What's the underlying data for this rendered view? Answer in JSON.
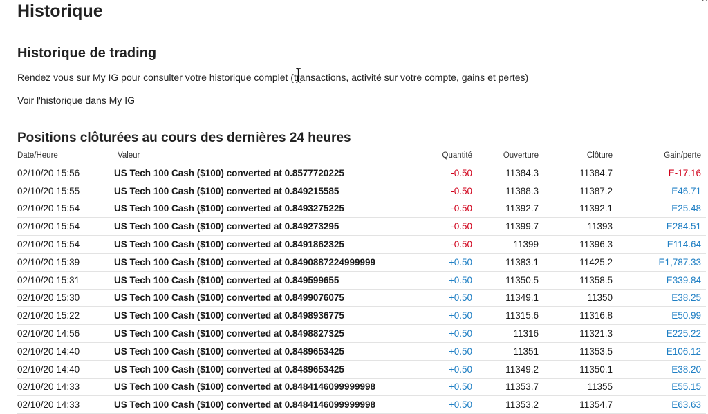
{
  "header": {
    "title": "Historique",
    "close_label": "×"
  },
  "trading_history": {
    "title": "Historique de trading",
    "description": "Rendez vous sur My IG pour consulter votre historique complet (transactions, activité sur votre compte, gains et pertes)",
    "link_label": "Voir l'historique dans My IG"
  },
  "closed_positions": {
    "title": "Positions clôturées au cours des dernières 24 heures",
    "columns": {
      "date": "Date/Heure",
      "value": "Valeur",
      "quantity": "Quantité",
      "open": "Ouverture",
      "close": "Clôture",
      "pl": "Gain/perte"
    },
    "rows": [
      {
        "date": "02/10/20 15:56",
        "value": "US Tech 100 Cash ($100) converted at 0.8577720225",
        "quantity": "-0.50",
        "open": "11384.3",
        "close": "11384.7",
        "pl": "E-17.16",
        "qty_sign": "neg",
        "pl_sign": "neg"
      },
      {
        "date": "02/10/20 15:55",
        "value": "US Tech 100 Cash ($100) converted at 0.849215585",
        "quantity": "-0.50",
        "open": "11388.3",
        "close": "11387.2",
        "pl": "E46.71",
        "qty_sign": "neg",
        "pl_sign": "pos"
      },
      {
        "date": "02/10/20 15:54",
        "value": "US Tech 100 Cash ($100) converted at 0.8493275225",
        "quantity": "-0.50",
        "open": "11392.7",
        "close": "11392.1",
        "pl": "E25.48",
        "qty_sign": "neg",
        "pl_sign": "pos"
      },
      {
        "date": "02/10/20 15:54",
        "value": "US Tech 100 Cash ($100) converted at 0.849273295",
        "quantity": "-0.50",
        "open": "11399.7",
        "close": "11393",
        "pl": "E284.51",
        "qty_sign": "neg",
        "pl_sign": "pos"
      },
      {
        "date": "02/10/20 15:54",
        "value": "US Tech 100 Cash ($100) converted at 0.8491862325",
        "quantity": "-0.50",
        "open": "11399",
        "close": "11396.3",
        "pl": "E114.64",
        "qty_sign": "neg",
        "pl_sign": "pos"
      },
      {
        "date": "02/10/20 15:39",
        "value": "US Tech 100 Cash ($100) converted at 0.8490887224999999",
        "quantity": "+0.50",
        "open": "11383.1",
        "close": "11425.2",
        "pl": "E1,787.33",
        "qty_sign": "pos",
        "pl_sign": "pos"
      },
      {
        "date": "02/10/20 15:31",
        "value": "US Tech 100 Cash ($100) converted at 0.849599655",
        "quantity": "+0.50",
        "open": "11350.5",
        "close": "11358.5",
        "pl": "E339.84",
        "qty_sign": "pos",
        "pl_sign": "pos"
      },
      {
        "date": "02/10/20 15:30",
        "value": "US Tech 100 Cash ($100) converted at 0.8499076075",
        "quantity": "+0.50",
        "open": "11349.1",
        "close": "11350",
        "pl": "E38.25",
        "qty_sign": "pos",
        "pl_sign": "pos"
      },
      {
        "date": "02/10/20 15:22",
        "value": "US Tech 100 Cash ($100) converted at 0.8498936775",
        "quantity": "+0.50",
        "open": "11315.6",
        "close": "11316.8",
        "pl": "E50.99",
        "qty_sign": "pos",
        "pl_sign": "pos"
      },
      {
        "date": "02/10/20 14:56",
        "value": "US Tech 100 Cash ($100) converted at 0.8498827325",
        "quantity": "+0.50",
        "open": "11316",
        "close": "11321.3",
        "pl": "E225.22",
        "qty_sign": "pos",
        "pl_sign": "pos"
      },
      {
        "date": "02/10/20 14:40",
        "value": "US Tech 100 Cash ($100) converted at 0.8489653425",
        "quantity": "+0.50",
        "open": "11351",
        "close": "11353.5",
        "pl": "E106.12",
        "qty_sign": "pos",
        "pl_sign": "pos"
      },
      {
        "date": "02/10/20 14:40",
        "value": "US Tech 100 Cash ($100) converted at 0.8489653425",
        "quantity": "+0.50",
        "open": "11349.2",
        "close": "11350.1",
        "pl": "E38.20",
        "qty_sign": "pos",
        "pl_sign": "pos"
      },
      {
        "date": "02/10/20 14:33",
        "value": "US Tech 100 Cash ($100) converted at 0.8484146099999998",
        "quantity": "+0.50",
        "open": "11353.7",
        "close": "11355",
        "pl": "E55.15",
        "qty_sign": "pos",
        "pl_sign": "pos"
      },
      {
        "date": "02/10/20 14:33",
        "value": "US Tech 100 Cash ($100) converted at 0.8484146099999998",
        "quantity": "+0.50",
        "open": "11353.2",
        "close": "11354.7",
        "pl": "E63.63",
        "qty_sign": "pos",
        "pl_sign": "pos"
      }
    ]
  },
  "colors": {
    "negative": "#d0021b",
    "positive": "#1f7fc4"
  }
}
